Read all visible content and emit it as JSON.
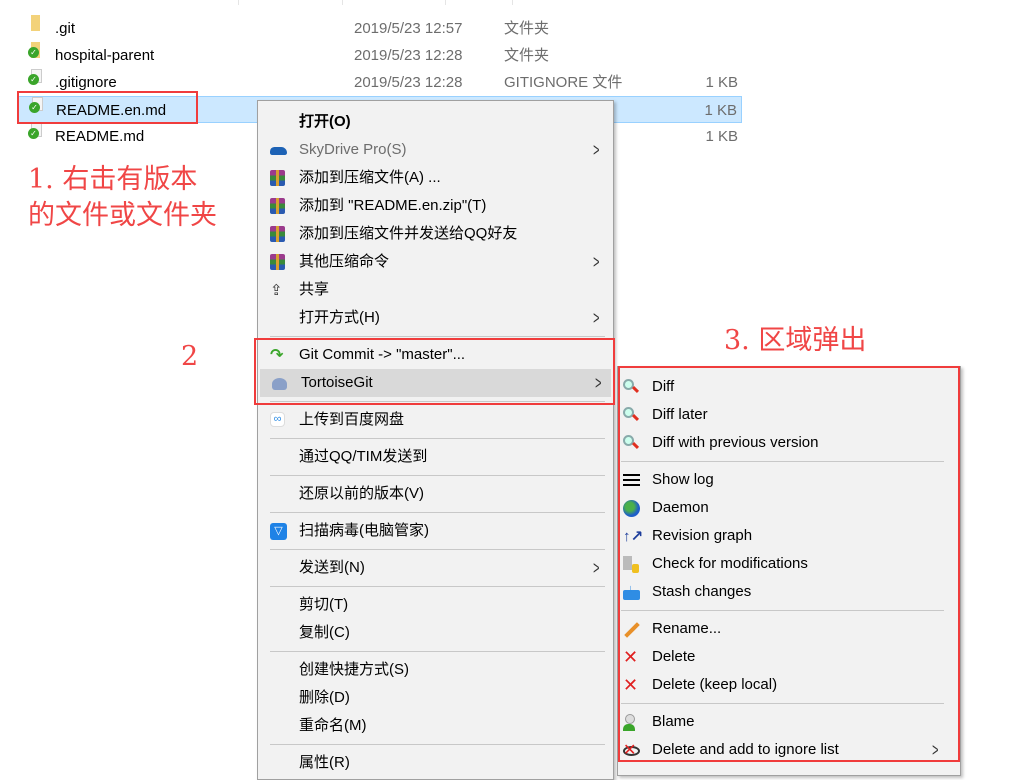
{
  "files": [
    {
      "name": ".git",
      "date": "2019/5/23 12:57",
      "type": "文件夹",
      "size": "",
      "icon": "folder-icon"
    },
    {
      "name": "hospital-parent",
      "date": "2019/5/23 12:28",
      "type": "文件夹",
      "size": "",
      "icon": "folder-git-ok-icon"
    },
    {
      "name": ".gitignore",
      "date": "2019/5/23 12:28",
      "type": "GITIGNORE 文件",
      "size": "1 KB",
      "icon": "file-git-added-icon"
    },
    {
      "name": "README.en.md",
      "date": "",
      "type": "",
      "size": "1 KB",
      "icon": "file-git-ok-icon",
      "selected": true
    },
    {
      "name": "README.md",
      "date": "",
      "type": "",
      "size": "1 KB",
      "icon": "file-git-ok-icon"
    }
  ],
  "annotations": {
    "step1_line1": "1. 右击有版本",
    "step1_line2": "的文件或文件夹",
    "step2": "2",
    "step3": "3. 区域弹出",
    "color": "#f04646"
  },
  "context_menu": [
    {
      "label": "打开(O)",
      "bold": true
    },
    {
      "label": "SkyDrive Pro(S)",
      "icon": "cloud-icon",
      "submenu": true,
      "disabled": true
    },
    {
      "label": "添加到压缩文件(A) ...",
      "icon": "winrar-icon"
    },
    {
      "label": "添加到 \"README.en.zip\"(T)",
      "icon": "winrar-icon"
    },
    {
      "label": "添加到压缩文件并发送给QQ好友",
      "icon": "winrar-icon"
    },
    {
      "label": "其他压缩命令",
      "icon": "winrar-icon",
      "submenu": true
    },
    {
      "label": "共享",
      "icon": "share-icon"
    },
    {
      "label": "打开方式(H)",
      "submenu": true
    },
    {
      "sep": true
    },
    {
      "label": "Git Commit -> \"master\"...",
      "icon": "git-commit-icon"
    },
    {
      "label": "TortoiseGit",
      "icon": "tortoisegit-icon",
      "submenu": true,
      "highlighted": true
    },
    {
      "sep": true
    },
    {
      "label": "上传到百度网盘",
      "icon": "baidu-netdisk-icon"
    },
    {
      "sep": true
    },
    {
      "label": "通过QQ/TIM发送到"
    },
    {
      "sep": true
    },
    {
      "label": "还原以前的版本(V)"
    },
    {
      "sep": true
    },
    {
      "label": "扫描病毒(电脑管家)",
      "icon": "tencent-pc-manager-icon"
    },
    {
      "sep": true
    },
    {
      "label": "发送到(N)",
      "submenu": true
    },
    {
      "sep": true
    },
    {
      "label": "剪切(T)"
    },
    {
      "label": "复制(C)"
    },
    {
      "sep": true
    },
    {
      "label": "创建快捷方式(S)"
    },
    {
      "label": "删除(D)"
    },
    {
      "label": "重命名(M)"
    },
    {
      "sep": true
    },
    {
      "label": "属性(R)"
    }
  ],
  "tortoisegit_submenu": [
    {
      "label": "Diff",
      "icon": "magnifier-icon"
    },
    {
      "label": "Diff later",
      "icon": "magnifier-icon"
    },
    {
      "label": "Diff with previous version",
      "icon": "magnifier-icon"
    },
    {
      "sep": true
    },
    {
      "label": "Show log",
      "icon": "log-icon"
    },
    {
      "label": "Daemon",
      "icon": "globe-icon"
    },
    {
      "label": "Revision graph",
      "icon": "revision-graph-icon"
    },
    {
      "label": "Check for modifications",
      "icon": "check-modifications-icon"
    },
    {
      "label": "Stash changes",
      "icon": "stash-icon"
    },
    {
      "sep": true
    },
    {
      "label": "Rename...",
      "icon": "pencil-icon"
    },
    {
      "label": "Delete",
      "icon": "red-x-icon"
    },
    {
      "label": "Delete (keep local)",
      "icon": "red-x-icon"
    },
    {
      "sep": true
    },
    {
      "label": "Blame",
      "icon": "blame-icon"
    },
    {
      "label": "Delete and add to ignore list",
      "icon": "ignore-icon",
      "submenu": true
    }
  ],
  "colors": {
    "selection": "#cce8ff",
    "menu_bg": "#f2f2f2",
    "menu_highlight": "#d9d9d9",
    "annotation_red": "#f03c3c"
  }
}
